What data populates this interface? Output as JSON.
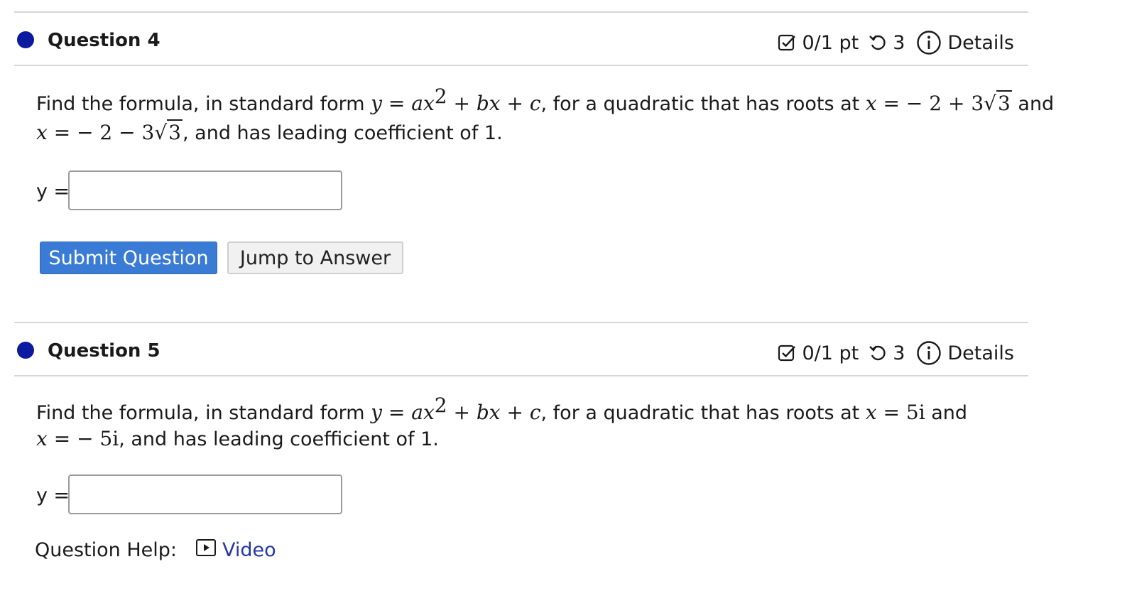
{
  "questions": [
    {
      "title": "Question 4",
      "points": "0/1 pt",
      "tries": "3",
      "details_label": "Details",
      "answer_label": "y =",
      "answer_value": ""
    },
    {
      "title": "Question 5",
      "points": "0/1 pt",
      "tries": "3",
      "details_label": "Details",
      "answer_label": "y =",
      "answer_value": ""
    }
  ],
  "q4": {
    "text_a": "Find the formula, in standard form ",
    "text_b": ", for a quadratic that has roots at ",
    "text_c": " and",
    "text_d": ", and has leading coefficient of 1.",
    "root1": "− 2 + 3",
    "root1_rad": "3",
    "root2": "− 2 − 3",
    "root2_rad": "3"
  },
  "q5": {
    "text_a": "Find the formula, in standard form ",
    "text_b": ", for a quadratic that has roots at ",
    "text_c": " and",
    "text_d": ", and has leading coefficient of 1.",
    "root1": "5i",
    "root2": "− 5i"
  },
  "buttons": {
    "submit": "Submit Question",
    "jump": "Jump to Answer"
  },
  "help": {
    "label": "Question Help:",
    "video": "Video"
  },
  "colors": {
    "status_dot": "#0b1a9e",
    "submit_bg": "#3a7bd5",
    "link": "#2536a8"
  }
}
